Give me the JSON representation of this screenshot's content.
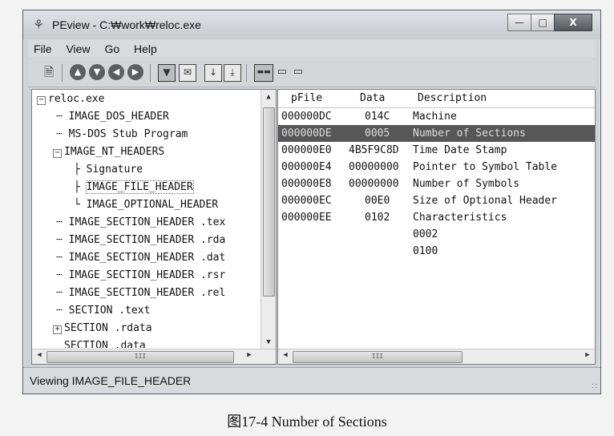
{
  "window": {
    "title": "PEview - C:₩work₩reloc.exe",
    "buttons": {
      "minimize": "—",
      "maximize": "□",
      "close": "X"
    }
  },
  "menu": [
    "File",
    "View",
    "Go",
    "Help"
  ],
  "toolbar": {
    "icons": [
      "open-file-icon",
      "back-icon",
      "forward-icon",
      "previous-icon",
      "next-icon",
      "view-header-icon",
      "view-mail-icon",
      "import-icon",
      "export-icon",
      "hex-view-icon",
      "word-view-icon",
      "dword-view-icon"
    ]
  },
  "tree": [
    {
      "label": "reloc.exe",
      "expander": "−"
    },
    {
      "label": "IMAGE_DOS_HEADER"
    },
    {
      "label": "MS-DOS Stub Program"
    },
    {
      "label": "IMAGE_NT_HEADERS",
      "expander": "−"
    },
    {
      "label": "Signature"
    },
    {
      "label": "IMAGE_FILE_HEADER",
      "selected": true
    },
    {
      "label": "IMAGE_OPTIONAL_HEADER"
    },
    {
      "label": "IMAGE_SECTION_HEADER .tex"
    },
    {
      "label": "IMAGE_SECTION_HEADER .rda"
    },
    {
      "label": "IMAGE_SECTION_HEADER .dat"
    },
    {
      "label": "IMAGE_SECTION_HEADER .rsr"
    },
    {
      "label": "IMAGE_SECTION_HEADER .rel"
    },
    {
      "label": "SECTION .text"
    },
    {
      "label": "SECTION .rdata",
      "expander": "+"
    },
    {
      "label": "SECTION .data"
    }
  ],
  "table": {
    "headers": [
      "pFile",
      "Data",
      "Description"
    ],
    "rows": [
      {
        "pfile": "000000DC",
        "data": "014C",
        "desc": "Machine"
      },
      {
        "pfile": "000000DE",
        "data": "0005",
        "desc": "Number of Sections",
        "selected": true
      },
      {
        "pfile": "000000E0",
        "data": "4B5F9C8D",
        "desc": "Time Date Stamp"
      },
      {
        "pfile": "000000E4",
        "data": "00000000",
        "desc": "Pointer to Symbol Table"
      },
      {
        "pfile": "000000E8",
        "data": "00000000",
        "desc": "Number of Symbols"
      },
      {
        "pfile": "000000EC",
        "data": "00E0",
        "desc": "Size of Optional Header"
      },
      {
        "pfile": "000000EE",
        "data": "0102",
        "desc": "Characteristics"
      },
      {
        "pfile": "",
        "data": "",
        "desc": "0002"
      },
      {
        "pfile": "",
        "data": "",
        "desc": "0100"
      }
    ]
  },
  "scroll": {
    "h_thumb_label": "III"
  },
  "status": "Viewing IMAGE_FILE_HEADER",
  "caption": "图17-4   Number of Sections",
  "colors": {
    "selection": "#575757",
    "window_frame": "#cfd2d6"
  }
}
